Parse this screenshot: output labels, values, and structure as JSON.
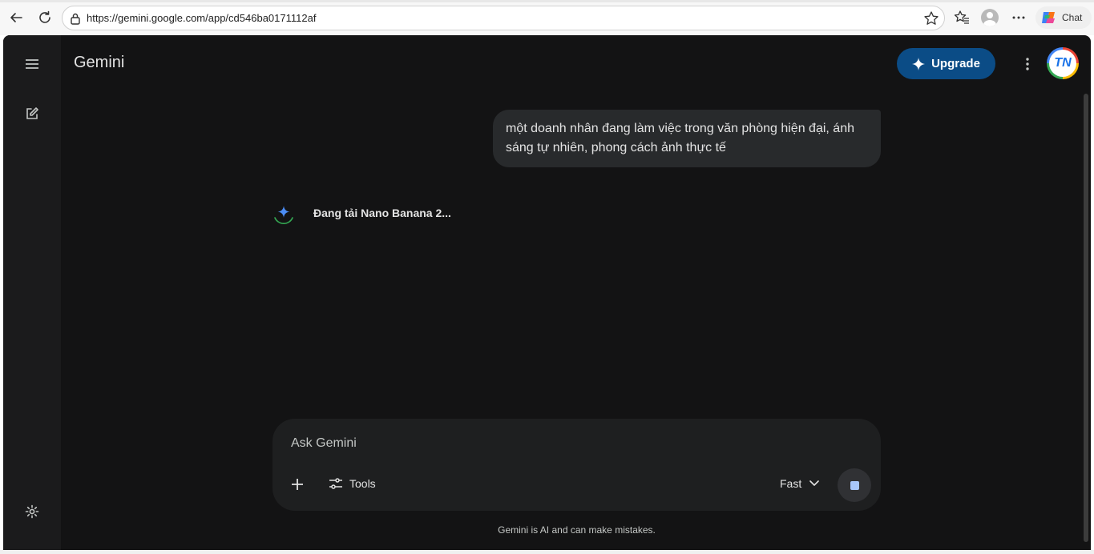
{
  "browser": {
    "url": "https://gemini.google.com/app/cd546ba0171112af",
    "chat_label": "Chat"
  },
  "app": {
    "brand": "Gemini",
    "upgrade_label": "Upgrade",
    "avatar_text": "TN"
  },
  "conversation": {
    "user_prompt": "một doanh nhân đang làm việc trong văn phòng hiện đại, ánh sáng tự nhiên, phong cách ảnh thực tế",
    "loading_text": "Đang tải Nano Banana 2..."
  },
  "composer": {
    "placeholder": "Ask Gemini",
    "tools_label": "Tools",
    "mode_label": "Fast"
  },
  "footer": {
    "disclaimer": "Gemini is AI and can make mistakes."
  },
  "colors": {
    "background": "#131314",
    "sidebar": "#1b1b1c",
    "accent": "#0b4c86"
  }
}
